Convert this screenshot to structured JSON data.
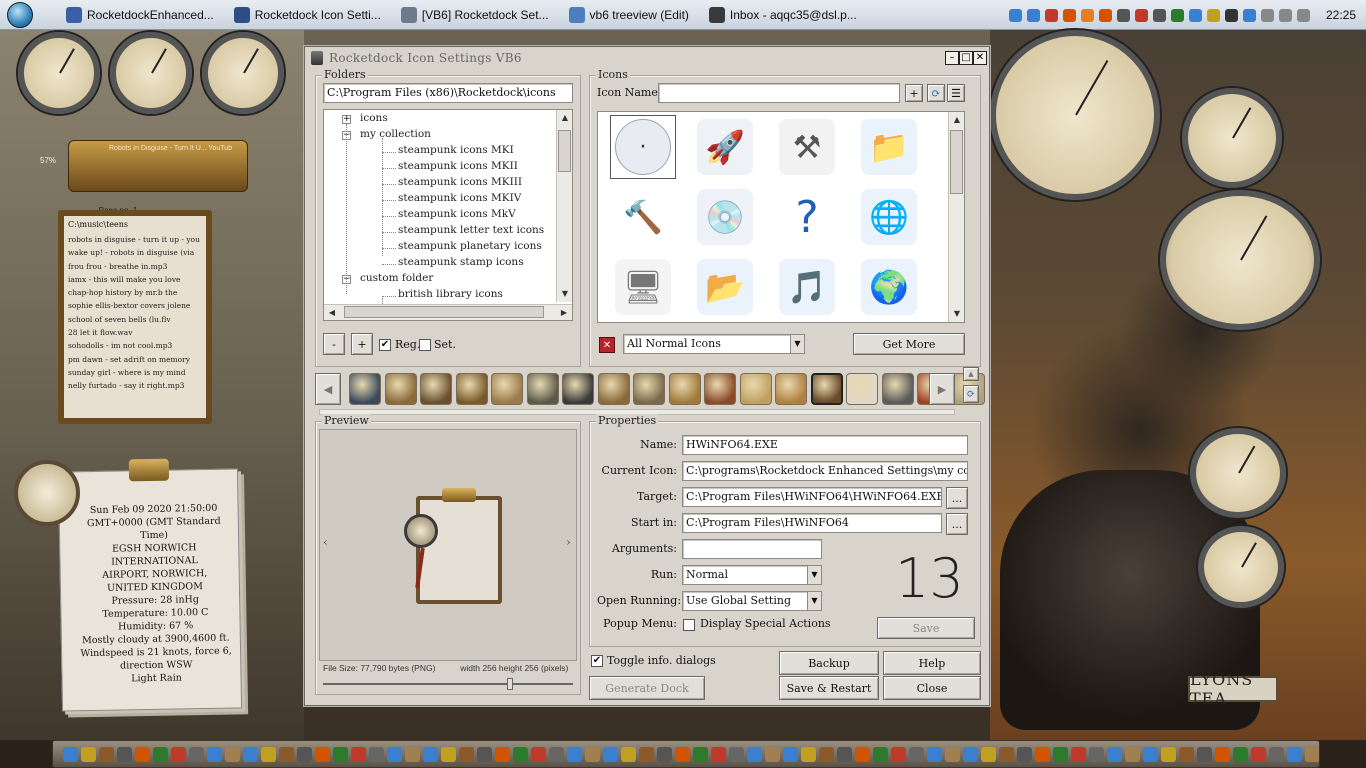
{
  "taskbar": {
    "tasks": [
      {
        "label": "RocketdockEnhanced...",
        "color": "#3b5ea8"
      },
      {
        "label": "Rocketdock Icon Setti...",
        "color": "#2e4f86"
      },
      {
        "label": "[VB6] Rocketdock Set...",
        "color": "#6d7a8e"
      },
      {
        "label": "vb6 treeview (Edit)",
        "color": "#4d7fbf"
      },
      {
        "label": "Inbox - aqqc35@dsl.p...",
        "color": "#3a3a3a"
      }
    ],
    "clock": "22:25"
  },
  "media_player": {
    "title": "Robots In Disguise - Turn It U...  YouTub",
    "volume": "57%",
    "page": "Page no. 1",
    "path": "C:\\music\\teens",
    "tracks": [
      "robots in disguise - turn it up - you",
      "wake up! - robots in disguise (via",
      "frou frou - breathe in.mp3",
      "iamx - this will make you love",
      "chap-hop history by mr.b the",
      "sophie ellis-bextor covers jolene",
      "school of seven bells (lu.flv",
      "28 let it flow.wav",
      "sohodolls - im not cool.mp3",
      "pm dawn - set adrift on memory",
      "sunday girl - where is my mind",
      "nelly furtado - say it right.mp3"
    ]
  },
  "weather": {
    "lines": [
      "Sun Feb 09 2020 21:50:00",
      "GMT+0000 (GMT Standard",
      "Time)",
      "EGSH NORWICH",
      "INTERNATIONAL",
      "AIRPORT, NORWICH,",
      "UNITED KINGDOM",
      "Pressure: 28 inHg",
      "Temperature: 10.00 C",
      "Humidity: 67 %",
      "Mostly cloudy at 3900,4600 ft.",
      "Windspeed is 21 knots, force 6,",
      "direction WSW",
      "Light Rain"
    ]
  },
  "desktop": {
    "train_sign": "LYONS TEA"
  },
  "window": {
    "title": "Rocketdock Icon Settings VB6",
    "folders": {
      "label": "Folders",
      "path": "C:\\Program Files (x86)\\Rocketdock\\icons",
      "tree": [
        {
          "label": "icons",
          "level": 0,
          "expander": "+"
        },
        {
          "label": "my collection",
          "level": 0,
          "expander": "−"
        },
        {
          "label": "steampunk icons MKI",
          "level": 1
        },
        {
          "label": "steampunk icons MKII",
          "level": 1
        },
        {
          "label": "steampunk icons MKIII",
          "level": 1
        },
        {
          "label": "steampunk icons MKIV",
          "level": 1
        },
        {
          "label": "steampunk icons MkV",
          "level": 1
        },
        {
          "label": "steampunk letter text icons",
          "level": 1
        },
        {
          "label": "steampunk planetary icons",
          "level": 1
        },
        {
          "label": "steampunk stamp icons",
          "level": 1
        },
        {
          "label": "custom folder",
          "level": 0,
          "expander": "−"
        },
        {
          "label": "british library icons",
          "level": 1
        }
      ],
      "minus": "-",
      "plus": "+",
      "reg_label": "Reg.",
      "reg_checked": "✔",
      "set_label": "Set."
    },
    "icons": {
      "label": "Icons",
      "name_label": "Icon Name:",
      "name_value": "",
      "add": "+",
      "filter_value": "All Normal Icons",
      "filter_clear": "✕",
      "get_more": "Get More",
      "grid": [
        {
          "name": "clock-face-icon",
          "glyph": "·",
          "color": "#e8ecf2",
          "fg": "#334"
        },
        {
          "name": "space-shuttle-icon",
          "glyph": "🚀",
          "color": "#eef1f6",
          "fg": "#3a5ea8"
        },
        {
          "name": "tools-icon",
          "glyph": "⚒",
          "color": "#f2f2f2",
          "fg": "#555"
        },
        {
          "name": "folder-icon",
          "glyph": "📁",
          "color": "#eaf2fb",
          "fg": "#5d8fcb"
        },
        {
          "name": "hammer-icon",
          "glyph": "🔨",
          "color": "#fff",
          "fg": "#6b4a2b"
        },
        {
          "name": "disc-drive-icon",
          "glyph": "💿",
          "color": "#eef2f8",
          "fg": "#4a78b8"
        },
        {
          "name": "help-question-icon",
          "glyph": "?",
          "color": "#fff",
          "fg": "#1f5fb8"
        },
        {
          "name": "globe-icon",
          "glyph": "🌐",
          "color": "#eaf2fb",
          "fg": "#2b6bb8"
        },
        {
          "name": "monitor-document-icon",
          "glyph": "🖥",
          "color": "#f4f4f4",
          "fg": "#777"
        },
        {
          "name": "documents-folder-icon",
          "glyph": "📂",
          "color": "#eaf2fb",
          "fg": "#5d8fcb"
        },
        {
          "name": "music-folder-icon",
          "glyph": "🎵",
          "color": "#eaf2fb",
          "fg": "#2e8b57"
        },
        {
          "name": "network-globe-icon",
          "glyph": "🌍",
          "color": "#eaf2fb",
          "fg": "#2b6bb8"
        }
      ]
    },
    "preview": {
      "label": "Preview",
      "prev": "‹",
      "next": "›",
      "file_size": "File Size: 77,790 bytes (PNG)",
      "dimensions": "width 256 height 256 (pixels)"
    },
    "properties": {
      "label": "Properties",
      "name_label": "Name:",
      "name_value": "HWiNFO64.EXE",
      "current_icon_label": "Current Icon:",
      "current_icon_value": "C:\\programs\\Rocketdock Enhanced Settings\\my collection\\h",
      "target_label": "Target:",
      "target_value": "C:\\Program Files\\HWiNFO64\\HWiNFO64.EXE",
      "start_in_label": "Start in:",
      "start_in_value": "C:\\Program Files\\HWiNFO64",
      "arguments_label": "Arguments:",
      "arguments_value": "",
      "run_label": "Run:",
      "run_value": "Normal",
      "open_running_label": "Open Running:",
      "open_running_value": "Use Global Setting",
      "popup_label": "Popup Menu:",
      "popup_option": "Display Special Actions",
      "browse": "...",
      "count": "13",
      "save": "Save"
    },
    "footer": {
      "toggle_label": "Toggle info. dialogs",
      "toggle_checked": "✔",
      "generate_dock": "Generate Dock",
      "backup": "Backup",
      "help": "Help",
      "save_restart": "Save & Restart",
      "close": "Close"
    }
  },
  "colors": {
    "window_bg": "#d8d4cc",
    "accent_red": "#b8232c"
  }
}
